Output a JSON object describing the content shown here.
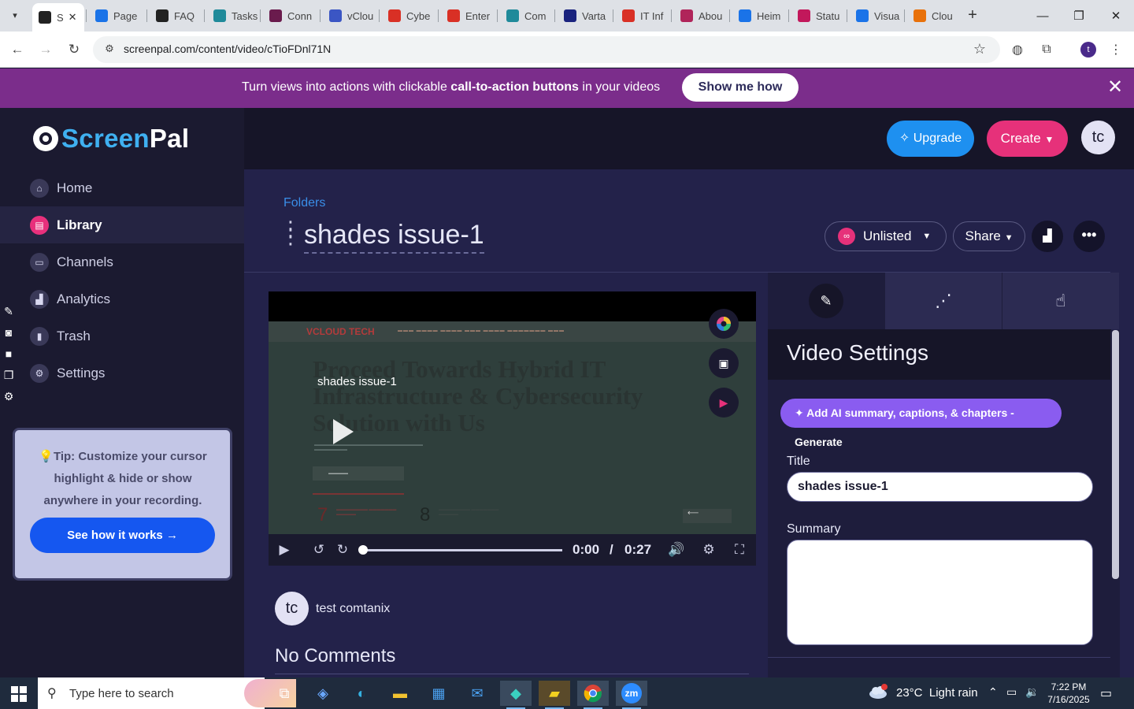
{
  "browser": {
    "tabs": [
      {
        "label": "S",
        "icon": "screenpal-icon",
        "color": "#222222",
        "active": true
      },
      {
        "label": "Page",
        "icon": "page-icon",
        "color": "#1a73e8"
      },
      {
        "label": "FAQ",
        "icon": "faq-icon",
        "color": "#222222"
      },
      {
        "label": "Tasks",
        "icon": "tasks-icon",
        "color": "#1f8a9a"
      },
      {
        "label": "Conn",
        "icon": "v-icon",
        "color": "#6a1b4d"
      },
      {
        "label": "vClou",
        "icon": "vcloud-icon",
        "color": "#3b56c4"
      },
      {
        "label": "Cybe",
        "icon": "cyber-icon",
        "color": "#d93025"
      },
      {
        "label": "Enter",
        "icon": "enter-icon",
        "color": "#d93025"
      },
      {
        "label": "Com",
        "icon": "com-icon",
        "color": "#1f8a9a"
      },
      {
        "label": "Varta",
        "icon": "varta-icon",
        "color": "#1a237e"
      },
      {
        "label": "IT Inf",
        "icon": "itinf-icon",
        "color": "#d93025"
      },
      {
        "label": "Abou",
        "icon": "about-icon",
        "color": "#b0245a"
      },
      {
        "label": "Heim",
        "icon": "heim-icon",
        "color": "#1a73e8"
      },
      {
        "label": "Statu",
        "icon": "status-icon",
        "color": "#c2185b"
      },
      {
        "label": "Visua",
        "icon": "visual-icon",
        "color": "#1a73e8"
      },
      {
        "label": "Clou",
        "icon": "cloud-icon",
        "color": "#e8710a"
      }
    ],
    "url": "screenpal.com/content/video/cTioFDnl71N",
    "profile_initial": "t"
  },
  "promo": {
    "text_before": "Turn views into actions with clickable ",
    "text_bold": "call-to-action buttons",
    "text_after": " in your videos",
    "button": "Show me how"
  },
  "sidebar": {
    "logo_part1": "Screen",
    "logo_part2": "Pal",
    "items": [
      {
        "label": "Home",
        "icon": "home-icon"
      },
      {
        "label": "Library",
        "icon": "library-icon",
        "active": true
      },
      {
        "label": "Channels",
        "icon": "channels-icon"
      },
      {
        "label": "Analytics",
        "icon": "analytics-icon"
      },
      {
        "label": "Trash",
        "icon": "trash-icon"
      },
      {
        "label": "Settings",
        "icon": "settings-icon"
      }
    ],
    "tip": {
      "text": "Tip: Customize your cursor highlight & hide or show anywhere in your recording.",
      "button": "See how it works"
    }
  },
  "header": {
    "upgrade": "Upgrade",
    "create": "Create",
    "avatar": "tc"
  },
  "page": {
    "breadcrumb": "Folders",
    "title": "shades issue-1",
    "visibility": "Unlisted",
    "share": "Share"
  },
  "video": {
    "overlay_title": "shades issue-1",
    "brand": "VCLOUD TECH",
    "hero_text": "Proceed Towards Hybrid IT Infrastructure & Cybersecurity Solution with Us",
    "current_time": "0:00",
    "separator": "/",
    "duration": "0:27",
    "progress": 0
  },
  "owner": {
    "initials": "tc",
    "name": "test comtanix"
  },
  "comments": {
    "heading": "No Comments"
  },
  "settings": {
    "heading": "Video Settings",
    "ai_button": "Add AI summary, captions, & chapters - Generate",
    "title_label": "Title",
    "title_value": "shades issue-1",
    "summary_label": "Summary",
    "summary_value": ""
  },
  "taskbar": {
    "search_placeholder": "Type here to search",
    "temperature": "23°C",
    "weather": "Light rain",
    "weather_badge": "1",
    "time": "7:22 PM",
    "date": "7/16/2025"
  }
}
